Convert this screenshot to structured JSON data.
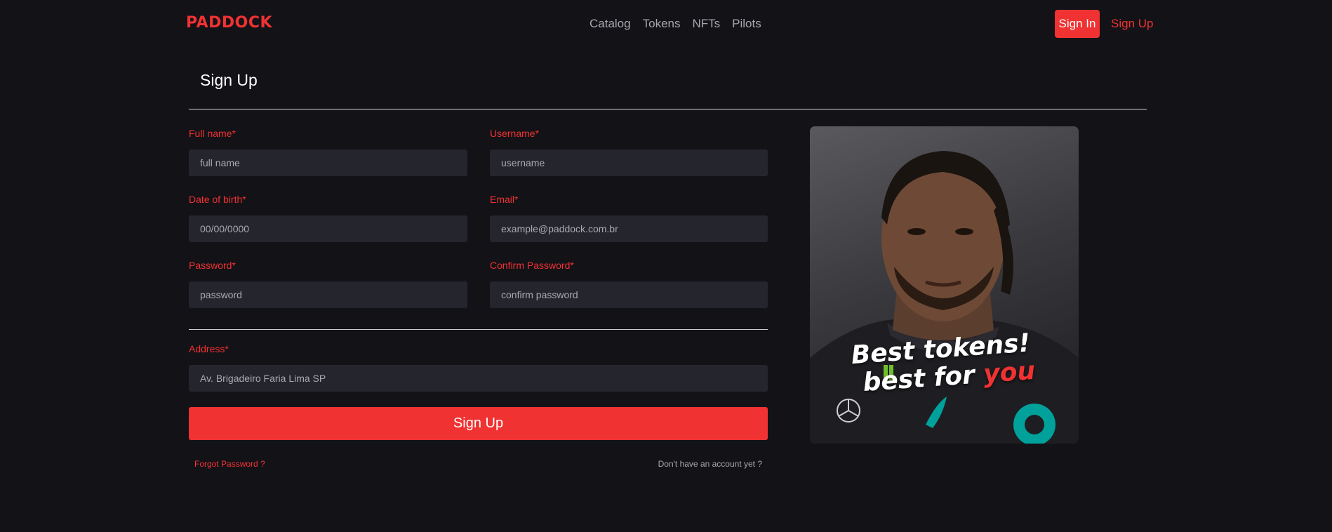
{
  "brand": {
    "logo": "PADDOCK",
    "accent_color": "#f03232"
  },
  "nav": {
    "links": [
      "Catalog",
      "Tokens",
      "NFTs",
      "Pilots"
    ],
    "sign_in": "Sign In",
    "sign_up": "Sign Up"
  },
  "page": {
    "title": "Sign Up"
  },
  "form": {
    "full_name": {
      "label": "Full name*",
      "placeholder": "full name"
    },
    "username": {
      "label": "Username*",
      "placeholder": "username"
    },
    "dob": {
      "label": "Date of birth*",
      "placeholder": "00/00/0000"
    },
    "email": {
      "label": "Email*",
      "placeholder": "example@paddock.com.br"
    },
    "password": {
      "label": "Password*",
      "placeholder": "password"
    },
    "confirm_password": {
      "label": "Confirm Password*",
      "placeholder": "confirm password"
    },
    "address": {
      "label": "Address*",
      "placeholder": "Av. Brigadeiro Faria Lima SP"
    },
    "submit": "Sign Up",
    "forgot": "Forgot Password ?",
    "no_account": "Don't have an account yet ?"
  },
  "promo": {
    "line1": "Best tokens!",
    "line2_prefix": "best for ",
    "line2_accent": "you"
  }
}
